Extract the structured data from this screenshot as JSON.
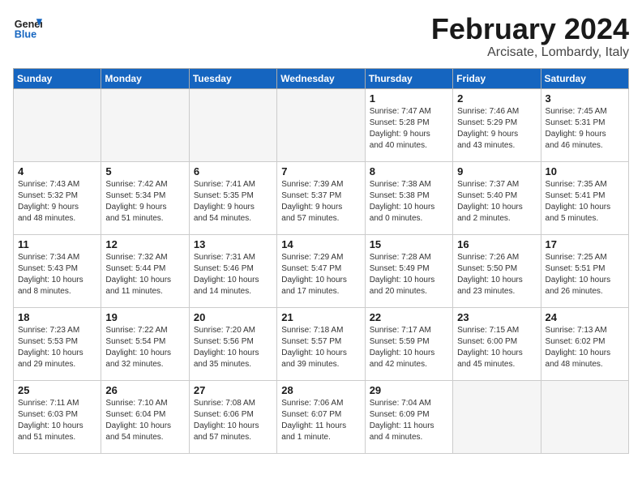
{
  "header": {
    "logo_general": "General",
    "logo_blue": "Blue",
    "month_title": "February 2024",
    "subtitle": "Arcisate, Lombardy, Italy"
  },
  "weekdays": [
    "Sunday",
    "Monday",
    "Tuesday",
    "Wednesday",
    "Thursday",
    "Friday",
    "Saturday"
  ],
  "weeks": [
    [
      {
        "day": "",
        "info": ""
      },
      {
        "day": "",
        "info": ""
      },
      {
        "day": "",
        "info": ""
      },
      {
        "day": "",
        "info": ""
      },
      {
        "day": "1",
        "info": "Sunrise: 7:47 AM\nSunset: 5:28 PM\nDaylight: 9 hours\nand 40 minutes."
      },
      {
        "day": "2",
        "info": "Sunrise: 7:46 AM\nSunset: 5:29 PM\nDaylight: 9 hours\nand 43 minutes."
      },
      {
        "day": "3",
        "info": "Sunrise: 7:45 AM\nSunset: 5:31 PM\nDaylight: 9 hours\nand 46 minutes."
      }
    ],
    [
      {
        "day": "4",
        "info": "Sunrise: 7:43 AM\nSunset: 5:32 PM\nDaylight: 9 hours\nand 48 minutes."
      },
      {
        "day": "5",
        "info": "Sunrise: 7:42 AM\nSunset: 5:34 PM\nDaylight: 9 hours\nand 51 minutes."
      },
      {
        "day": "6",
        "info": "Sunrise: 7:41 AM\nSunset: 5:35 PM\nDaylight: 9 hours\nand 54 minutes."
      },
      {
        "day": "7",
        "info": "Sunrise: 7:39 AM\nSunset: 5:37 PM\nDaylight: 9 hours\nand 57 minutes."
      },
      {
        "day": "8",
        "info": "Sunrise: 7:38 AM\nSunset: 5:38 PM\nDaylight: 10 hours\nand 0 minutes."
      },
      {
        "day": "9",
        "info": "Sunrise: 7:37 AM\nSunset: 5:40 PM\nDaylight: 10 hours\nand 2 minutes."
      },
      {
        "day": "10",
        "info": "Sunrise: 7:35 AM\nSunset: 5:41 PM\nDaylight: 10 hours\nand 5 minutes."
      }
    ],
    [
      {
        "day": "11",
        "info": "Sunrise: 7:34 AM\nSunset: 5:43 PM\nDaylight: 10 hours\nand 8 minutes."
      },
      {
        "day": "12",
        "info": "Sunrise: 7:32 AM\nSunset: 5:44 PM\nDaylight: 10 hours\nand 11 minutes."
      },
      {
        "day": "13",
        "info": "Sunrise: 7:31 AM\nSunset: 5:46 PM\nDaylight: 10 hours\nand 14 minutes."
      },
      {
        "day": "14",
        "info": "Sunrise: 7:29 AM\nSunset: 5:47 PM\nDaylight: 10 hours\nand 17 minutes."
      },
      {
        "day": "15",
        "info": "Sunrise: 7:28 AM\nSunset: 5:49 PM\nDaylight: 10 hours\nand 20 minutes."
      },
      {
        "day": "16",
        "info": "Sunrise: 7:26 AM\nSunset: 5:50 PM\nDaylight: 10 hours\nand 23 minutes."
      },
      {
        "day": "17",
        "info": "Sunrise: 7:25 AM\nSunset: 5:51 PM\nDaylight: 10 hours\nand 26 minutes."
      }
    ],
    [
      {
        "day": "18",
        "info": "Sunrise: 7:23 AM\nSunset: 5:53 PM\nDaylight: 10 hours\nand 29 minutes."
      },
      {
        "day": "19",
        "info": "Sunrise: 7:22 AM\nSunset: 5:54 PM\nDaylight: 10 hours\nand 32 minutes."
      },
      {
        "day": "20",
        "info": "Sunrise: 7:20 AM\nSunset: 5:56 PM\nDaylight: 10 hours\nand 35 minutes."
      },
      {
        "day": "21",
        "info": "Sunrise: 7:18 AM\nSunset: 5:57 PM\nDaylight: 10 hours\nand 39 minutes."
      },
      {
        "day": "22",
        "info": "Sunrise: 7:17 AM\nSunset: 5:59 PM\nDaylight: 10 hours\nand 42 minutes."
      },
      {
        "day": "23",
        "info": "Sunrise: 7:15 AM\nSunset: 6:00 PM\nDaylight: 10 hours\nand 45 minutes."
      },
      {
        "day": "24",
        "info": "Sunrise: 7:13 AM\nSunset: 6:02 PM\nDaylight: 10 hours\nand 48 minutes."
      }
    ],
    [
      {
        "day": "25",
        "info": "Sunrise: 7:11 AM\nSunset: 6:03 PM\nDaylight: 10 hours\nand 51 minutes."
      },
      {
        "day": "26",
        "info": "Sunrise: 7:10 AM\nSunset: 6:04 PM\nDaylight: 10 hours\nand 54 minutes."
      },
      {
        "day": "27",
        "info": "Sunrise: 7:08 AM\nSunset: 6:06 PM\nDaylight: 10 hours\nand 57 minutes."
      },
      {
        "day": "28",
        "info": "Sunrise: 7:06 AM\nSunset: 6:07 PM\nDaylight: 11 hours\nand 1 minute."
      },
      {
        "day": "29",
        "info": "Sunrise: 7:04 AM\nSunset: 6:09 PM\nDaylight: 11 hours\nand 4 minutes."
      },
      {
        "day": "",
        "info": ""
      },
      {
        "day": "",
        "info": ""
      }
    ]
  ]
}
